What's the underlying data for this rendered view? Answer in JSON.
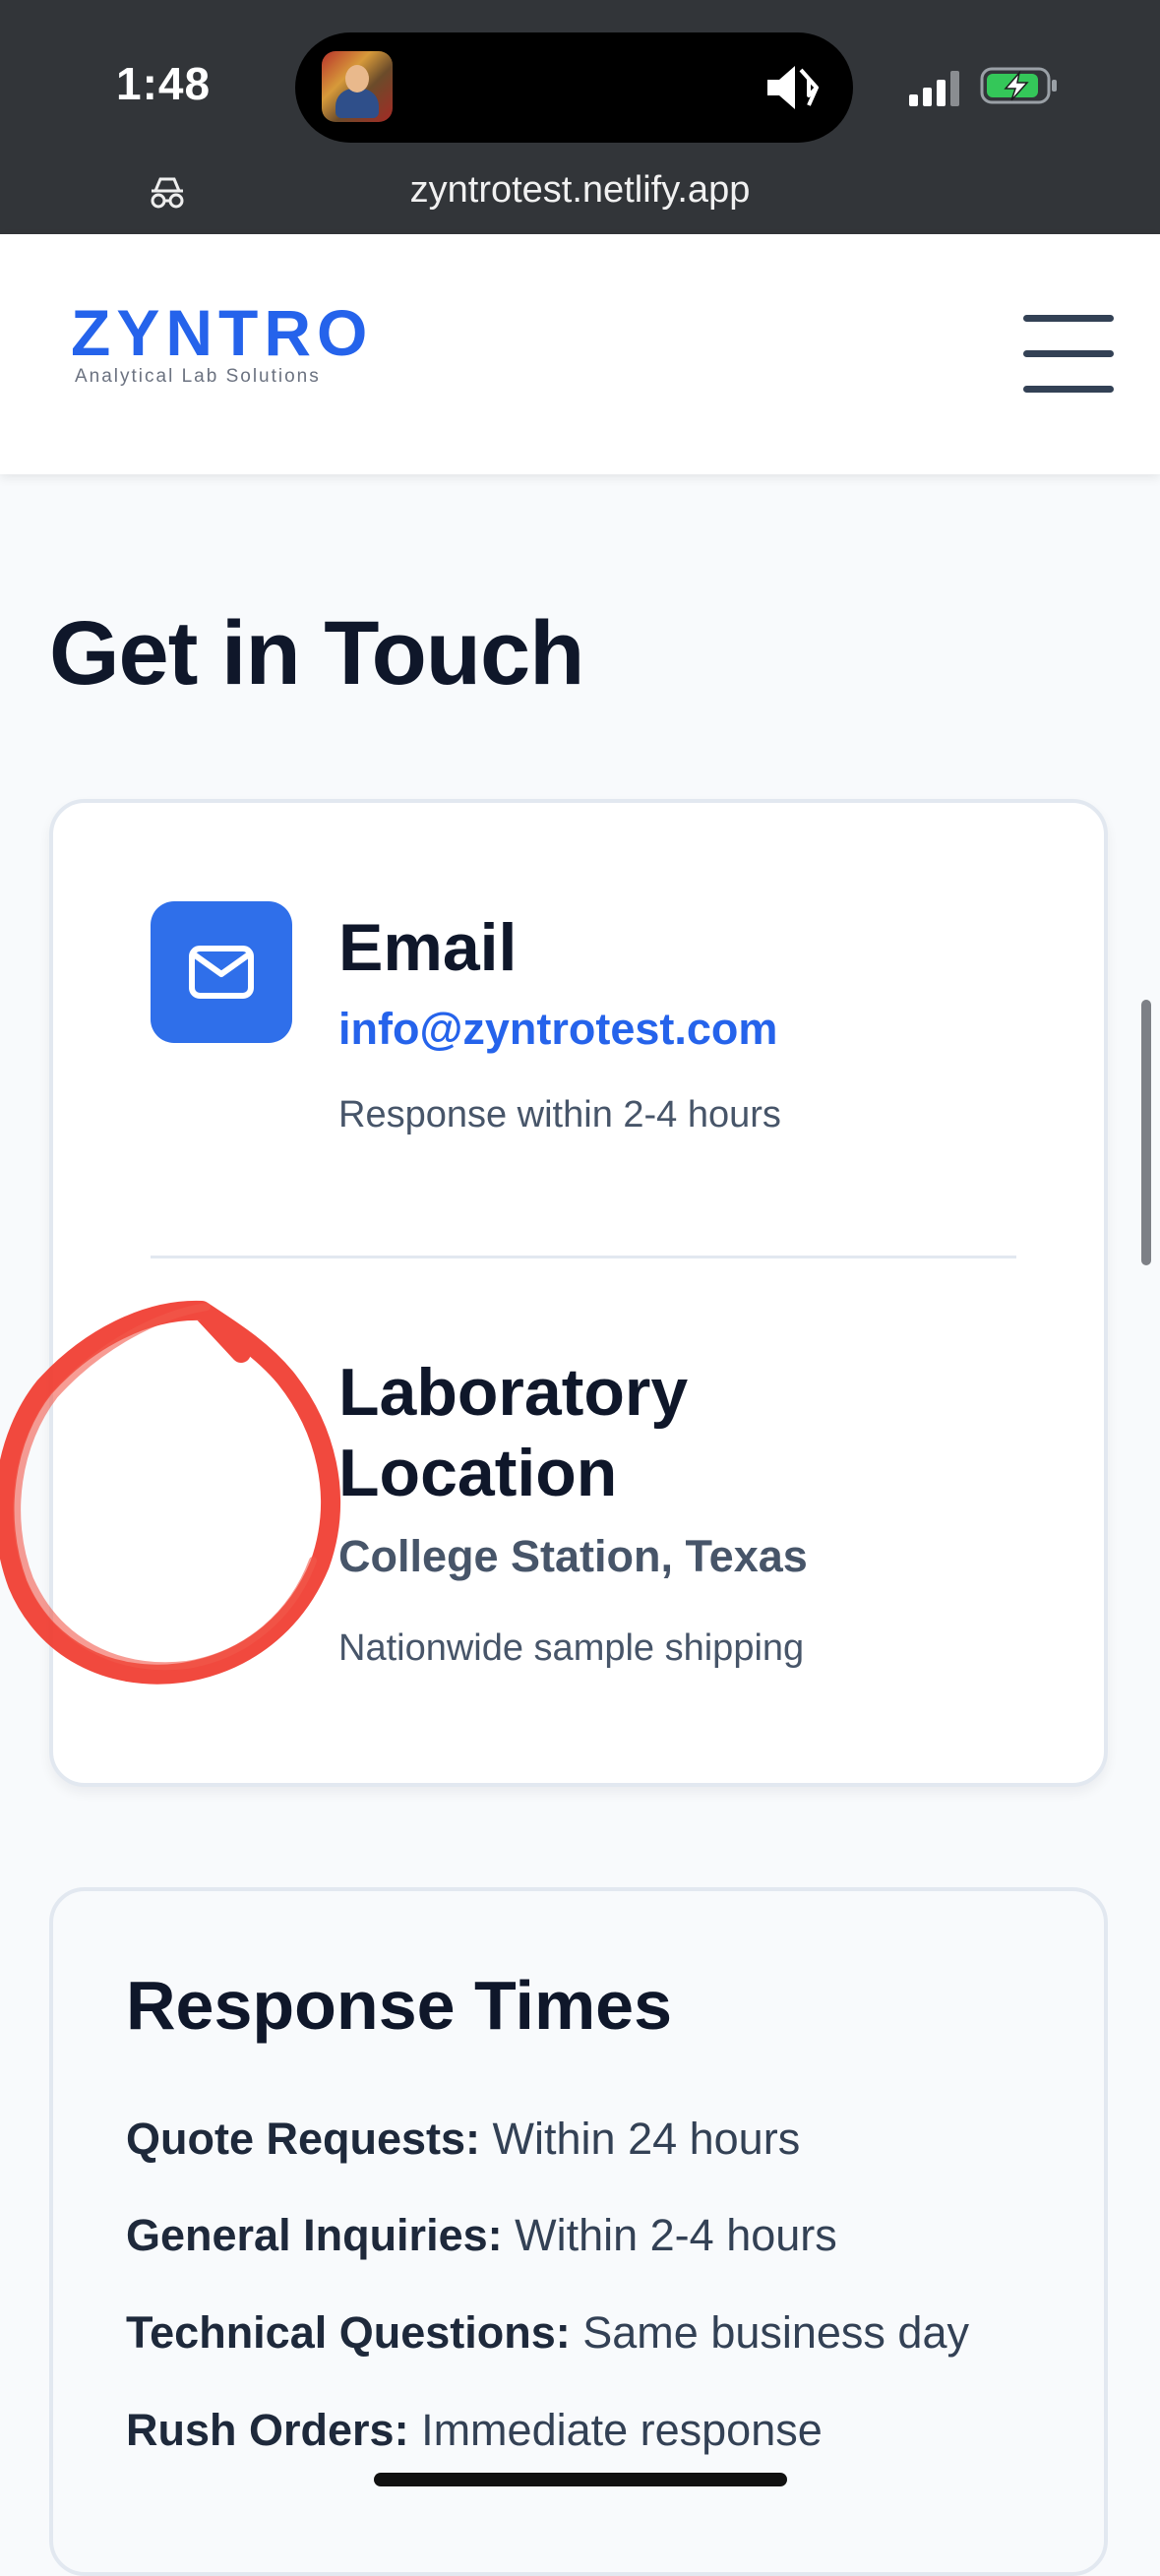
{
  "status_bar": {
    "time": "1:48",
    "url": "zyntrotest.netlify.app",
    "icons": [
      "now-playing-art",
      "speaker-muted-icon",
      "bluetooth-icon",
      "signal-icon",
      "battery-charging-icon",
      "privacy-icon"
    ]
  },
  "header": {
    "logo": "ZYNTRO",
    "tagline": "Analytical Lab Solutions",
    "menu_icon": "hamburger-menu-icon"
  },
  "main": {
    "title": "Get in Touch",
    "contact_card": {
      "email": {
        "heading": "Email",
        "address": "info@zyntrotest.com",
        "note": "Response within 2-4 hours",
        "icon": "envelope-icon"
      },
      "location": {
        "heading_line1": "Laboratory",
        "heading_line2": "Location",
        "place": "College Station, Texas",
        "note": "Nationwide sample shipping"
      }
    },
    "response_times": {
      "title": "Response Times",
      "rows": [
        {
          "label": "Quote Requests:",
          "value": " Within 24 hours"
        },
        {
          "label": "General Inquiries:",
          "value": " Within 2-4 hours"
        },
        {
          "label": "Technical Questions:",
          "value": " Same business day"
        },
        {
          "label": "Rush Orders:",
          "value": " Immediate response"
        }
      ]
    }
  },
  "colors": {
    "brand": "#2563eb",
    "heading": "#0f172a",
    "muted": "#475569",
    "annotation": "#f03a2e"
  }
}
